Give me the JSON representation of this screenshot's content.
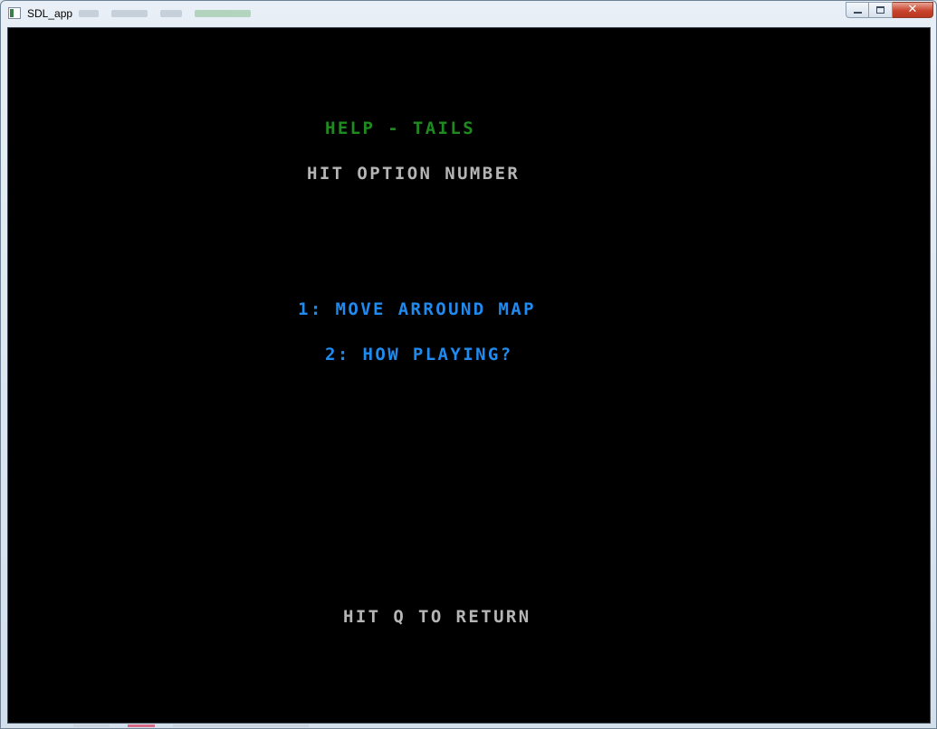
{
  "window": {
    "title": "SDL_app",
    "caption_buttons": {
      "minimize": "minimize-icon",
      "maximize": "maximize-icon",
      "close": "✕"
    }
  },
  "screen": {
    "heading": "HELP - TAILS",
    "prompt": "HIT OPTION NUMBER",
    "options": [
      "1: MOVE ARROUND MAP",
      "2: HOW PLAYING?"
    ],
    "footer": "HIT Q TO RETURN"
  },
  "colors": {
    "heading": "#1f8a1f",
    "prompt": "#b5b5b5",
    "options": "#1f8bf0",
    "background": "#000000"
  }
}
